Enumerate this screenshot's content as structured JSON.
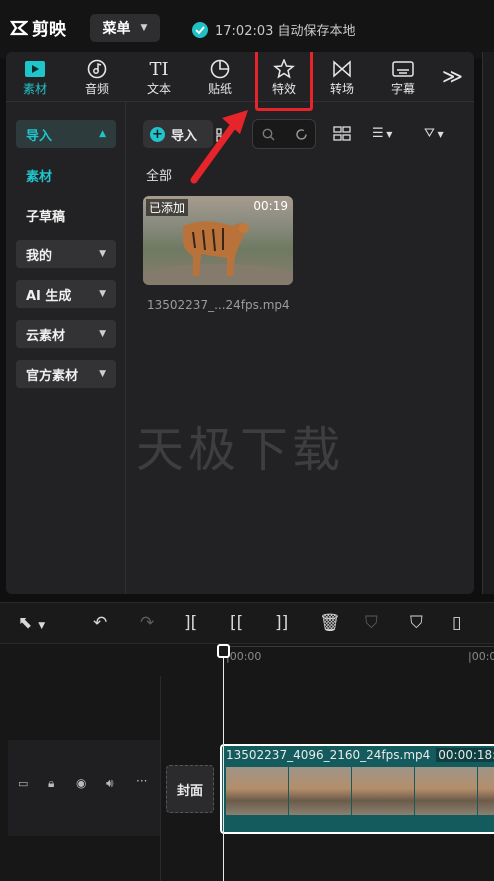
{
  "app": {
    "name": "剪映",
    "menu_label": "菜单",
    "autosave_text": "17:02:03 自动保存本地"
  },
  "toolbar": [
    {
      "label": "素材",
      "icon": "media-icon",
      "active": true
    },
    {
      "label": "音频",
      "icon": "audio-icon",
      "active": false
    },
    {
      "label": "文本",
      "icon": "text-icon",
      "active": false
    },
    {
      "label": "贴纸",
      "icon": "sticker-icon",
      "active": false
    },
    {
      "label": "特效",
      "icon": "effects-icon",
      "active": false,
      "highlighted": true
    },
    {
      "label": "转场",
      "icon": "transition-icon",
      "active": false
    },
    {
      "label": "字幕",
      "icon": "subtitle-icon",
      "active": false
    }
  ],
  "toolbar_more": "≫",
  "sidebar": {
    "import": "导入",
    "material": "素材",
    "draft": "子草稿",
    "mine": "我的",
    "ai": "AI 生成",
    "cloud": "云素材",
    "official": "官方素材"
  },
  "content": {
    "import_button": "导入",
    "filter_all": "全部",
    "media": {
      "badge": "已添加",
      "duration": "00:19",
      "filename": "13502237_...24fps.mp4"
    },
    "watermark": "天极下载"
  },
  "timeline": {
    "ruler_start": "|00:00",
    "ruler_next": "|00:0",
    "cover_label": "封面",
    "clip_name": "13502237_4096_2160_24fps.mp4",
    "clip_duration": "00:00:18:0"
  },
  "colors": {
    "accent": "#20c5cc",
    "highlight_box": "#e8242b",
    "clip": "#145b5e"
  }
}
